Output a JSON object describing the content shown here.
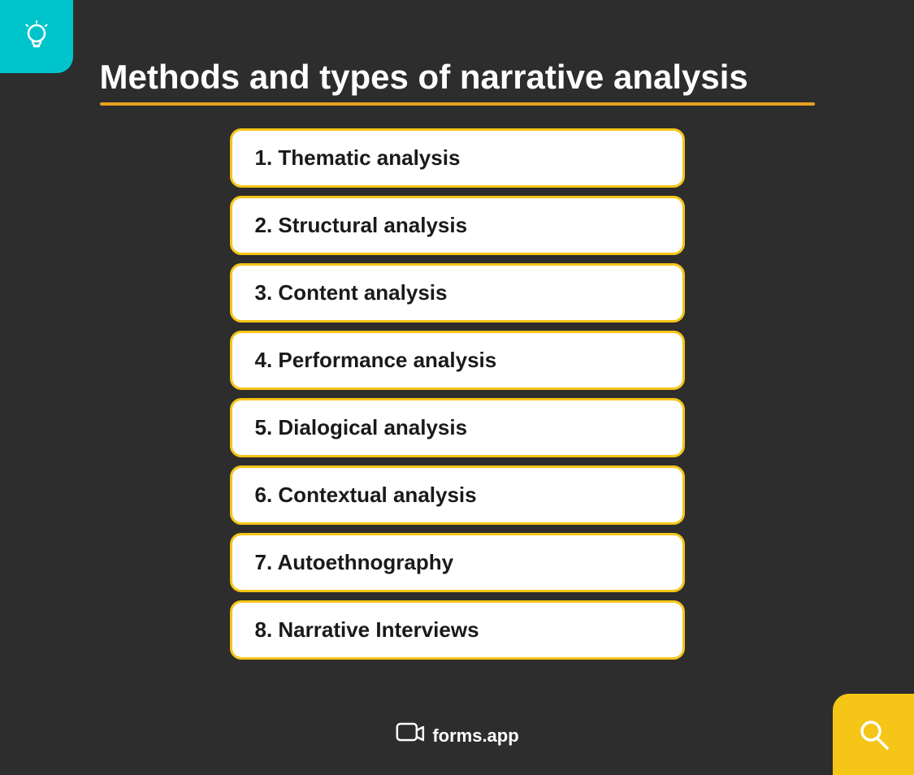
{
  "topBadge": {
    "color": "#00c4cc"
  },
  "bottomBadge": {
    "color": "#f5c518"
  },
  "title": "Methods and types of narrative analysis",
  "listItems": [
    {
      "id": 1,
      "text": "1.  Thematic analysis"
    },
    {
      "id": 2,
      "text": "2.  Structural analysis"
    },
    {
      "id": 3,
      "text": "3.  Content analysis"
    },
    {
      "id": 4,
      "text": "4.  Performance analysis"
    },
    {
      "id": 5,
      "text": "5.  Dialogical analysis"
    },
    {
      "id": 6,
      "text": "6.  Contextual analysis"
    },
    {
      "id": 7,
      "text": "7.  Autoethnography"
    },
    {
      "id": 8,
      "text": "8.  Narrative Interviews"
    }
  ],
  "footer": {
    "brand": "forms.app"
  }
}
